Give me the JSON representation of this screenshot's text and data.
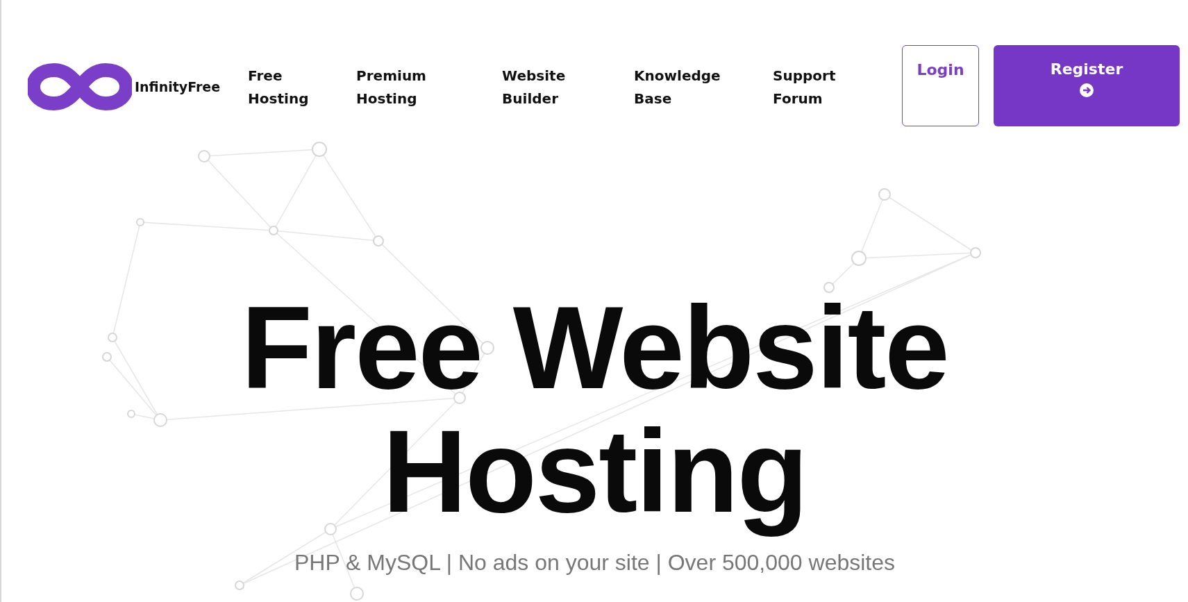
{
  "brand": {
    "name": "InfinityFree"
  },
  "nav": [
    {
      "label": "Free Hosting"
    },
    {
      "label": "Premium Hosting"
    },
    {
      "label": "Website Builder"
    },
    {
      "label": "Knowledge Base"
    },
    {
      "label": "Support Forum"
    }
  ],
  "login": {
    "label": "Login"
  },
  "register": {
    "label": "Register"
  },
  "hero": {
    "title": "Free Website Hosting",
    "subtitle": "PHP & MySQL | No ads on your site | Over 500,000 websites"
  }
}
